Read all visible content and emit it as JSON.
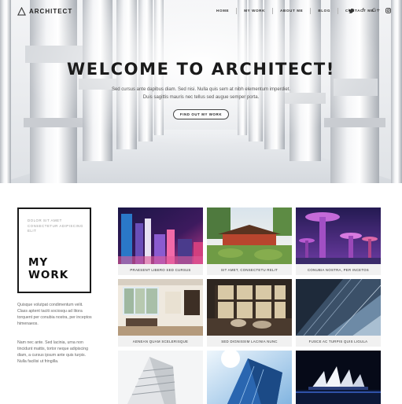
{
  "brand": {
    "name": "ARCHITECT"
  },
  "nav": {
    "items": [
      "HOME",
      "MY WORK",
      "ABOUT ME",
      "BLOG",
      "CONTACT ME"
    ],
    "socials": [
      "twitter-icon",
      "facebook-icon",
      "google-plus-icon",
      "instagram-icon"
    ]
  },
  "hero": {
    "title": "WELCOME TO ARCHITECT!",
    "subtitle_line1": "Sed cursus ante dapibus diam. Sed nisi. Nulla quis sem at nibh elementum imperdiet.",
    "subtitle_line2": "Duis sagittis mauris nec tellus sed augue semper porta.",
    "button": "FIND OUT MY WORK"
  },
  "mywork": {
    "kicker": "DOLOR SIT AMET CONSECTETUR ADIPISCING ELIT",
    "title": "MY\nWORK",
    "paragraph1": "Quisque volutpat condimentum velit. Class aptent taciti sociosqu ad litora torquent per conubia nostra, per inceptos himenaeos.",
    "paragraph2": "Nam nec ante. Sed lacinia, urna non tincidunt mattis, tortor neque adipiscing diam, a cursus ipsum ante quis turpis. Nulla facilisi ut fringilla."
  },
  "gallery": [
    {
      "caption": "PRAESENT LIBERO SED CURSUS"
    },
    {
      "caption": "SIT AMET, CONSECTETU RELIT"
    },
    {
      "caption": "CONUBIA NOSTRA, PER INCETOS"
    },
    {
      "caption": "AENEAN QUAM SCELERISQUE"
    },
    {
      "caption": "SED DIGNISSIM LACINIA NUNC"
    },
    {
      "caption": "FUSCE AC TURPIS QUIS LIGULA"
    },
    {
      "caption": ""
    },
    {
      "caption": ""
    },
    {
      "caption": ""
    }
  ]
}
